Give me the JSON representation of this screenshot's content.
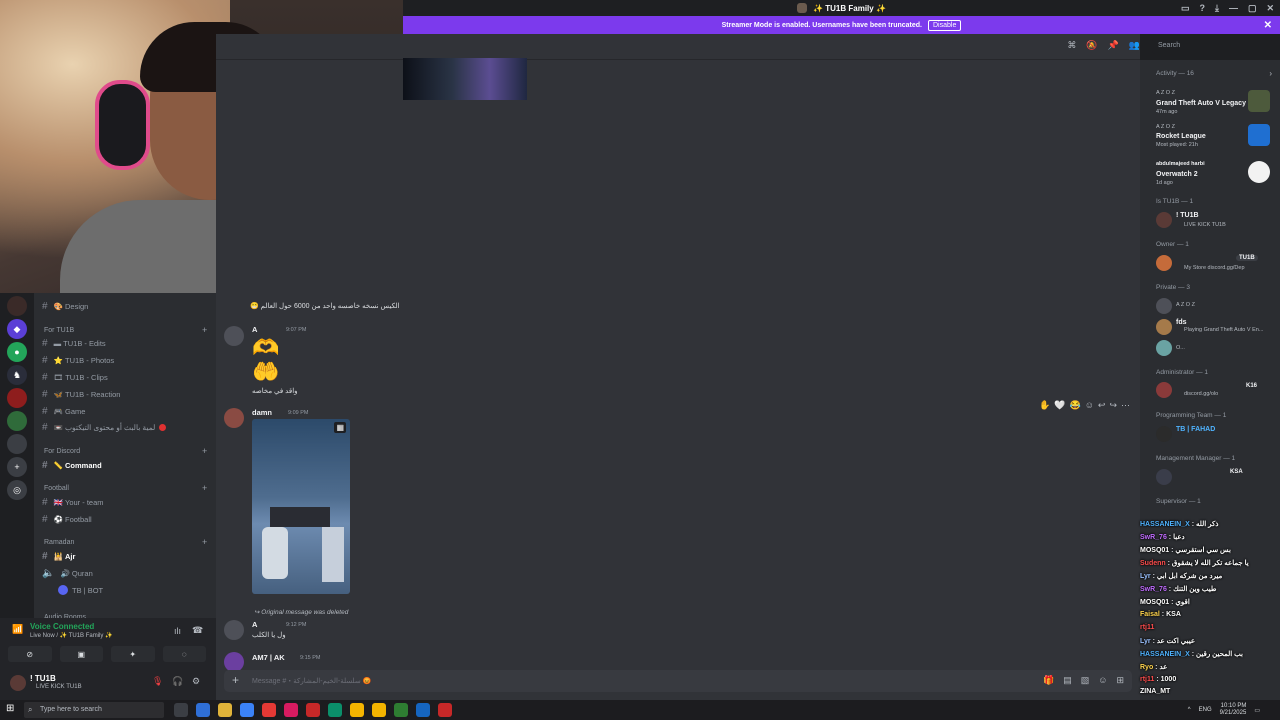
{
  "window": {
    "server_title": "✨ TU1B Family ✨",
    "controls": [
      "—",
      "▢",
      "✕"
    ]
  },
  "banner": {
    "text": "Streamer Mode is enabled. Usernames have been truncated.",
    "disable_label": "Disable"
  },
  "sidebar": {
    "items": [
      {
        "type": "channel",
        "label": "Design",
        "emoji": "🎨"
      },
      {
        "type": "category",
        "label": "For TU1B"
      },
      {
        "type": "channel",
        "label": "TU1B - Edits",
        "emoji": "▬"
      },
      {
        "type": "channel",
        "label": "TU1B - Photos",
        "emoji": "⭐"
      },
      {
        "type": "channel",
        "label": "TU1B - Clips",
        "emoji": "🎞"
      },
      {
        "type": "channel",
        "label": "TU1B - Reaction",
        "emoji": "🦋"
      },
      {
        "type": "channel",
        "label": "Game",
        "emoji": "🎮"
      },
      {
        "type": "channel",
        "label": "لمية بالبث أو محتوى التيكتوب",
        "emoji": "📼"
      },
      {
        "type": "category",
        "label": "For Discord"
      },
      {
        "type": "channel",
        "label": "Command",
        "emoji": "📏",
        "active": true
      },
      {
        "type": "category",
        "label": "Football"
      },
      {
        "type": "channel",
        "label": "Your - team",
        "emoji": "🇬🇧"
      },
      {
        "type": "channel",
        "label": "Football",
        "emoji": "⚽"
      },
      {
        "type": "category",
        "label": "Ramadan"
      },
      {
        "type": "channel",
        "label": "Ajr",
        "emoji": "🕌"
      },
      {
        "type": "channel",
        "label": "Quran",
        "emoji": "🔊"
      },
      {
        "type": "channel",
        "label": "TB | BOT",
        "emoji": ""
      },
      {
        "type": "category",
        "label": "Audio Rooms"
      }
    ]
  },
  "voice": {
    "title": "Voice Connected",
    "subtitle": "Live Now / ✨ TU1B Family ✨"
  },
  "user": {
    "name": "! TU1B",
    "status": "LIVE KICK TU1B"
  },
  "chat": {
    "search_placeholder": "Search",
    "messages": [
      {
        "text": "الكيس نسخه خاصسه واحد من 6000 حول العالم 😁"
      },
      {
        "author": "A",
        "time": "9:07 PM",
        "text": "واقد في مخاصه"
      },
      {
        "author": "damn",
        "time": "9:09 PM"
      },
      {
        "reply_note": "Original message was deleted",
        "author": "A",
        "time": "9:12 PM",
        "text": "ول يا الكلب"
      },
      {
        "author": "AM7 | AK",
        "time": "9:15 PM"
      }
    ],
    "reactions": [
      "✋",
      "🤍",
      "😂"
    ],
    "composer_placeholder": "Message #・سلسلة-الخيم-المشاركة 😡"
  },
  "members": {
    "activity_header": "Activity — 16",
    "activities": [
      {
        "user": "A Z O Z",
        "game": "Grand Theft Auto V Legacy",
        "detail": "47m ago"
      },
      {
        "user": "A Z O Z",
        "game": "Rocket League",
        "detail": "Most played: 21h"
      },
      {
        "user": "abdulmajeed harbi",
        "game": "Overwatch 2",
        "detail": "1d ago"
      }
    ],
    "groups": [
      {
        "header": "Is TU1B — 1",
        "name": "! TU1B",
        "status": "LIVE KICK TU1B"
      },
      {
        "header": "Owner — 1",
        "name": "TU1B",
        "status": "My Store discord.gg/Dep"
      },
      {
        "header": "Private — 3",
        "name": "A Z O Z",
        "status": ""
      },
      {
        "header": "",
        "name": "fds",
        "status": "Playing Grand Theft Auto V En..."
      },
      {
        "header": "",
        "name": "O...",
        "status": ""
      },
      {
        "header": "Administrator — 1",
        "name": "K16",
        "status": "discord.gg/olo"
      },
      {
        "header": "Programming Team — 1",
        "name": "TB | FAHAD",
        "status": ""
      },
      {
        "header": "Management Manager — 1",
        "name": "KSA",
        "status": ""
      },
      {
        "header": "Supervisor — 1",
        "name": "",
        "status": ""
      }
    ]
  },
  "stream_chat": [
    {
      "user": "HASSANEIN_X",
      "msg": "ذكر الله",
      "color": "#4fb3ff"
    },
    {
      "user": "SwR_76",
      "msg": "دعبا",
      "color": "#c06cff"
    },
    {
      "user": "MOSQ01",
      "msg": "بس سي استقرسي",
      "color": "#ffffff"
    },
    {
      "user": "Sudenn",
      "msg": "يا جماعه تكر الله لا يشقوق",
      "color": "#ff4d4d"
    },
    {
      "user": "Lyr",
      "msg": "ميرد من شركه ابل ابي",
      "color": "#9ac1ff"
    },
    {
      "user": "SwR_76",
      "msg": "طيب وين التنك",
      "color": "#c06cff"
    },
    {
      "user": "MOSQ01",
      "msg": "اقوي",
      "color": "#ffffff"
    },
    {
      "user": "Faisal",
      "msg": "KSA",
      "color": "#ffd44d"
    },
    {
      "user": "rtj11",
      "msg": "",
      "color": "#ff4d4d"
    },
    {
      "user": "Lyr",
      "msg": "عيبي اكت عد",
      "color": "#9ac1ff"
    },
    {
      "user": "HASSANEIN_X",
      "msg": "بب المحين رقين",
      "color": "#4fb3ff"
    },
    {
      "user": "Ryo",
      "msg": "عد",
      "color": "#ffd44d"
    },
    {
      "user": "rtj11",
      "msg": "1000",
      "color": "#ff4d4d"
    },
    {
      "user": "ZINA_MT",
      "msg": "",
      "color": "#ffffff"
    }
  ],
  "taskbar": {
    "search_placeholder": "Type here to search",
    "time": "10:10 PM",
    "date": "9/21/2025",
    "lang": "ENG"
  }
}
